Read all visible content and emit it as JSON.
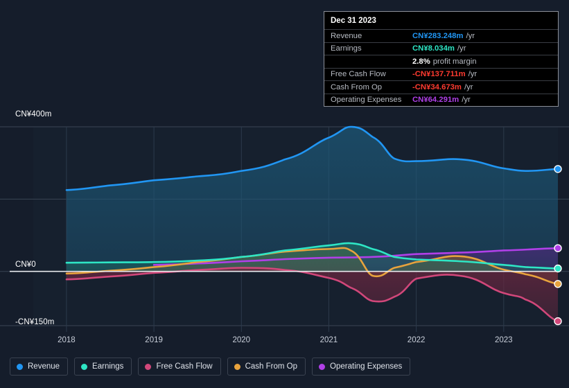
{
  "chart_data": {
    "type": "area",
    "title": "",
    "xlabel": "",
    "ylabel": "",
    "ylim": [
      -150,
      400
    ],
    "xlim": [
      2017.62,
      2023.62
    ],
    "grid": true,
    "y_ticks": [
      "CN¥400m",
      "CN¥0",
      "-CN¥150m"
    ],
    "y_tick_values": [
      400,
      0,
      -150
    ],
    "x_ticks": [
      "2018",
      "2019",
      "2020",
      "2021",
      "2022",
      "2023"
    ],
    "x_tick_values": [
      2018,
      2019,
      2020,
      2021,
      2022,
      2023
    ],
    "currency": "CN¥",
    "units": "m",
    "legend_position": "bottom",
    "series": [
      {
        "name": "Revenue",
        "color": "#2196f3",
        "fill": "#1d5878",
        "x": [
          2018.0,
          2018.5,
          2019.0,
          2019.5,
          2020.0,
          2020.5,
          2021.0,
          2021.25,
          2021.5,
          2021.75,
          2022.0,
          2022.5,
          2023.0,
          2023.25,
          2023.62
        ],
        "values": [
          225,
          238,
          252,
          263,
          278,
          310,
          370,
          400,
          372,
          312,
          305,
          310,
          285,
          278,
          283.248
        ]
      },
      {
        "name": "Earnings",
        "color": "#2ee6c5",
        "fill": "#1d6b63",
        "x": [
          2018.0,
          2018.5,
          2019.0,
          2019.5,
          2020.0,
          2020.5,
          2021.0,
          2021.25,
          2021.5,
          2021.75,
          2022.0,
          2022.5,
          2023.0,
          2023.25,
          2023.62
        ],
        "values": [
          24,
          25,
          26,
          30,
          40,
          58,
          72,
          78,
          62,
          40,
          33,
          28,
          18,
          12,
          8.034
        ]
      },
      {
        "name": "Free Cash Flow",
        "color": "#d1477a",
        "fill": "#6b2740",
        "x": [
          2018.0,
          2018.5,
          2019.0,
          2019.5,
          2020.0,
          2020.5,
          2021.0,
          2021.25,
          2021.5,
          2021.75,
          2022.0,
          2022.5,
          2023.0,
          2023.25,
          2023.62
        ],
        "values": [
          -22,
          -14,
          -4,
          4,
          10,
          4,
          -18,
          -45,
          -82,
          -70,
          -20,
          -12,
          -60,
          -78,
          -137.711
        ]
      },
      {
        "name": "Cash From Op",
        "color": "#e8a33d",
        "fill": "#7a5a2a",
        "x": [
          2018.0,
          2018.5,
          2019.0,
          2019.5,
          2020.0,
          2020.5,
          2021.0,
          2021.25,
          2021.5,
          2021.75,
          2022.0,
          2022.5,
          2023.0,
          2023.25,
          2023.62
        ],
        "values": [
          -6,
          2,
          12,
          26,
          40,
          55,
          62,
          58,
          -12,
          10,
          26,
          42,
          5,
          -8,
          -34.673
        ]
      },
      {
        "name": "Operating Expenses",
        "color": "#b040e8",
        "fill": "#4a2a78",
        "x": [
          2019.0,
          2019.5,
          2020.0,
          2020.5,
          2021.0,
          2021.5,
          2022.0,
          2022.5,
          2023.0,
          2023.62
        ],
        "values": [
          18,
          22,
          28,
          34,
          38,
          40,
          48,
          52,
          58,
          64.291
        ]
      }
    ]
  },
  "tooltip": {
    "date": "Dec 31 2023",
    "rows": [
      {
        "label": "Revenue",
        "value": "CN¥283.248m",
        "unit": "/yr",
        "color": "#2196f3"
      },
      {
        "label": "Earnings",
        "value": "CN¥8.034m",
        "unit": "/yr",
        "color": "#2ee6c5"
      },
      {
        "label": "",
        "value": "2.8%",
        "unit": "profit margin",
        "color": "#ffffff"
      },
      {
        "label": "Free Cash Flow",
        "value": "-CN¥137.711m",
        "unit": "/yr",
        "color": "#ff3b30"
      },
      {
        "label": "Cash From Op",
        "value": "-CN¥34.673m",
        "unit": "/yr",
        "color": "#ff3b30"
      },
      {
        "label": "Operating Expenses",
        "value": "CN¥64.291m",
        "unit": "/yr",
        "color": "#b040e8"
      }
    ]
  },
  "axis": {
    "y_top": "CN¥400m",
    "y_zero": "CN¥0",
    "y_bottom": "-CN¥150m"
  },
  "legend": {
    "items": [
      {
        "label": "Revenue",
        "color": "#2196f3"
      },
      {
        "label": "Earnings",
        "color": "#2ee6c5"
      },
      {
        "label": "Free Cash Flow",
        "color": "#d1477a"
      },
      {
        "label": "Cash From Op",
        "color": "#e8a33d"
      },
      {
        "label": "Operating Expenses",
        "color": "#b040e8"
      }
    ]
  }
}
